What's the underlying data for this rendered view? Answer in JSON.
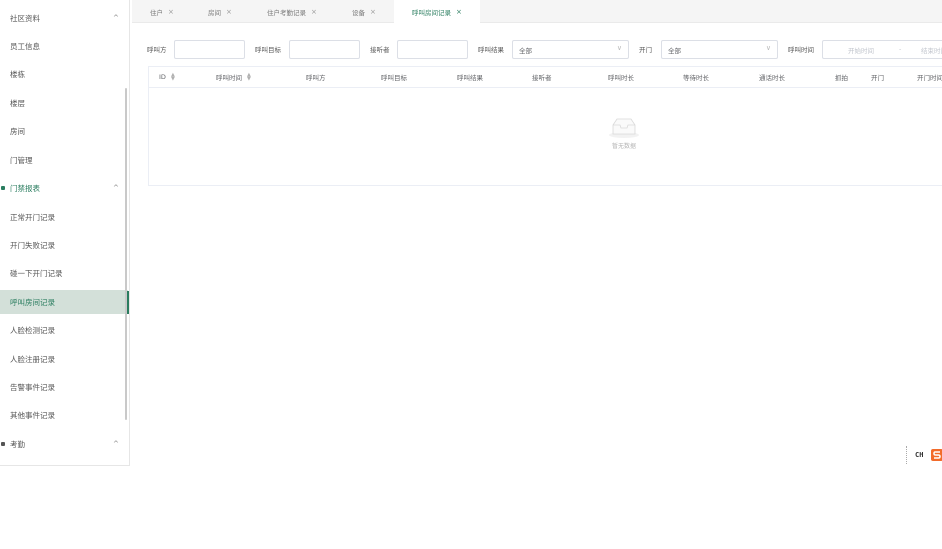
{
  "sidebar": {
    "groups": [
      {
        "label": "社区资料"
      },
      {
        "label": "门禁报表"
      },
      {
        "label": "考勤"
      }
    ],
    "community_items": [
      {
        "label": "员工信息"
      },
      {
        "label": "楼栋"
      },
      {
        "label": "楼层"
      },
      {
        "label": "房间"
      },
      {
        "label": "门管理"
      }
    ],
    "report_items": [
      {
        "label": "正常开门记录"
      },
      {
        "label": "开门失败记录"
      },
      {
        "label": "碰一下开门记录"
      },
      {
        "label": "呼叫房间记录"
      },
      {
        "label": "人脸检测记录"
      },
      {
        "label": "人脸注册记录"
      },
      {
        "label": "告警事件记录"
      },
      {
        "label": "其他事件记录"
      }
    ],
    "active_item": "呼叫房间记录",
    "accent_color": "#2a7d5f"
  },
  "tabs": [
    {
      "label": "住户"
    },
    {
      "label": "房间"
    },
    {
      "label": "住户考勤记录"
    },
    {
      "label": "设备"
    },
    {
      "label": "呼叫房间记录"
    }
  ],
  "active_tab": "呼叫房间记录",
  "filters": {
    "caller_label": "呼叫方",
    "caller_value": "",
    "target_label": "呼叫目标",
    "target_value": "",
    "answerer_label": "接听者",
    "answerer_value": "",
    "result_label": "呼叫结果",
    "result_value": "全部",
    "open_label": "开门",
    "open_value": "全部",
    "time_label": "呼叫时间",
    "start_placeholder": "开始时间",
    "range_sep": "-",
    "end_placeholder": "结束时间"
  },
  "table": {
    "columns": [
      {
        "label": "ID",
        "sortable": true
      },
      {
        "label": "呼叫时间",
        "sortable": true
      },
      {
        "label": "呼叫方",
        "sortable": false
      },
      {
        "label": "呼叫目标",
        "sortable": false
      },
      {
        "label": "呼叫结果",
        "sortable": false
      },
      {
        "label": "接听者",
        "sortable": false
      },
      {
        "label": "呼叫时长",
        "sortable": false
      },
      {
        "label": "等待时长",
        "sortable": false
      },
      {
        "label": "通话时长",
        "sortable": false
      },
      {
        "label": "抓拍",
        "sortable": false
      },
      {
        "label": "开门",
        "sortable": false
      },
      {
        "label": "开门时间",
        "sortable": false
      }
    ],
    "rows": [],
    "empty_text": "暂无数据"
  },
  "ime": {
    "lang": "CH",
    "icon": "sogou-s-icon"
  },
  "icons": {
    "caret_up": "caret-up-icon",
    "close": "close-icon",
    "dropdown": "chevron-down-icon",
    "sort": "sort-icon",
    "empty": "empty-box-icon"
  }
}
